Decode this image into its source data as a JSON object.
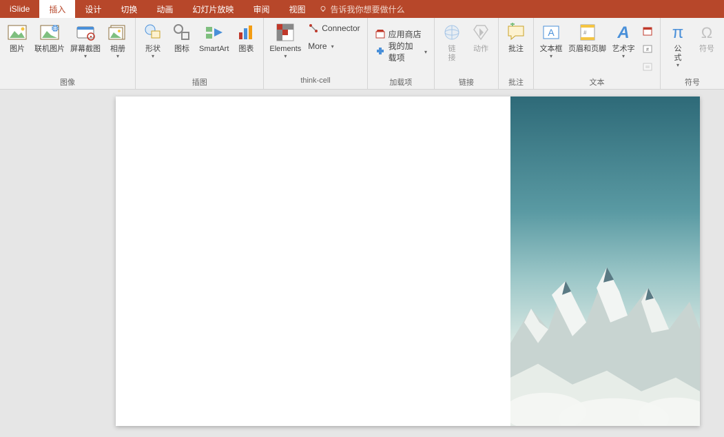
{
  "tabs": {
    "islide": "iSlide",
    "insert": "插入",
    "design": "设计",
    "transition": "切换",
    "animation": "动画",
    "slideshow": "幻灯片放映",
    "review": "审阅",
    "view": "视图"
  },
  "tellme": "告诉我你想要做什么",
  "groups": {
    "image": {
      "label": "图像",
      "picture": "图片",
      "online_picture": "联机图片",
      "screenshot": "屏幕截图",
      "album": "相册"
    },
    "illustration": {
      "label": "插图",
      "shapes": "形状",
      "icons": "图标",
      "smartart": "SmartArt",
      "chart": "图表"
    },
    "thinkcell": {
      "label": "think-cell",
      "elements": "Elements",
      "connector": "Connector",
      "more": "More"
    },
    "addins": {
      "label": "加载项",
      "store": "应用商店",
      "myaddins": "我的加载项"
    },
    "links": {
      "label": "链接",
      "hyperlink": "链\n接",
      "action": "动作"
    },
    "comments": {
      "label": "批注",
      "comment": "批注"
    },
    "text": {
      "label": "文本",
      "textbox": "文本框",
      "headerfooter": "页眉和页脚",
      "wordart": "艺术字"
    },
    "symbols": {
      "label": "符号",
      "equation": "公\n式",
      "symbol": "符号"
    }
  }
}
